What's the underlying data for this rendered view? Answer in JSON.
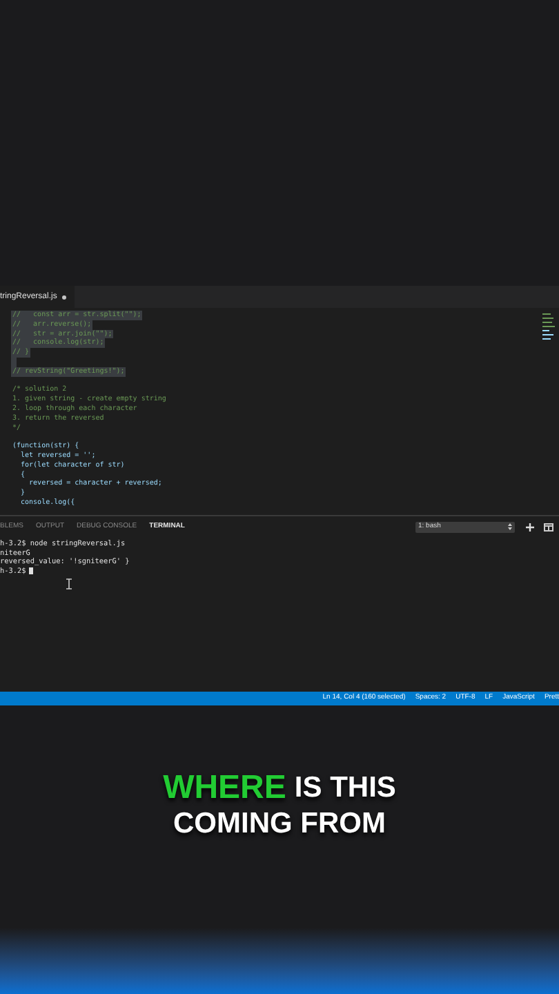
{
  "editor": {
    "tab": {
      "title": "tringReversal.js",
      "modified": true
    },
    "lines": [
      {
        "kind": "comment",
        "text": "//   const arr = str.split(\"\");",
        "selected": true
      },
      {
        "kind": "comment",
        "text": "//   arr.reverse();",
        "selected": true
      },
      {
        "kind": "comment",
        "text": "//   str = arr.join(\"\");",
        "selected": true
      },
      {
        "kind": "comment",
        "text": "//   console.log(str);",
        "selected": true
      },
      {
        "kind": "comment",
        "text": "// }",
        "selected": true
      },
      {
        "kind": "blank",
        "selected": true
      },
      {
        "kind": "comment",
        "text": "// revString(\"Greetings!\");",
        "selected": true
      },
      {
        "kind": "blank",
        "selected": false
      },
      {
        "kind": "comment",
        "text": "/* solution 2",
        "selected": false
      },
      {
        "kind": "comment",
        "text": "1. given string - create empty string",
        "selected": false
      },
      {
        "kind": "comment",
        "text": "2. loop through each character",
        "selected": false
      },
      {
        "kind": "comment",
        "text": "3. return the reversed",
        "selected": false
      },
      {
        "kind": "comment",
        "text": "*/",
        "selected": false
      },
      {
        "kind": "blank",
        "selected": false
      },
      {
        "kind": "code",
        "text": "(function(str) {",
        "selected": false
      },
      {
        "kind": "code",
        "text": "  let reversed = '';",
        "selected": false
      },
      {
        "kind": "code",
        "text": "  for(let character of str)",
        "selected": false
      },
      {
        "kind": "code",
        "text": "  {",
        "selected": false
      },
      {
        "kind": "code",
        "text": "    reversed = character + reversed;",
        "selected": false
      },
      {
        "kind": "code",
        "text": "  }",
        "selected": false
      },
      {
        "kind": "code",
        "text": "  console.log({",
        "selected": false
      }
    ]
  },
  "panel": {
    "tabs": [
      {
        "label": "BLEMS",
        "selected": false
      },
      {
        "label": "OUTPUT",
        "selected": false
      },
      {
        "label": "DEBUG CONSOLE",
        "selected": false
      },
      {
        "label": "TERMINAL",
        "selected": true
      }
    ],
    "shell": "1: bash",
    "terminal": [
      "h-3.2$ node stringReversal.js",
      "niteerG",
      "reversed_value: '!sgniteerG' }",
      "h-3.2$"
    ]
  },
  "status_bar": [
    "Ln 14, Col 4 (160 selected)",
    "Spaces: 2",
    "UTF-8",
    "LF",
    "JavaScript",
    "Prett"
  ],
  "caption": [
    [
      {
        "text": "WHERE",
        "highlight": true
      },
      {
        "text": "IS THIS",
        "highlight": false
      }
    ],
    [
      {
        "text": "COMING FROM",
        "highlight": false
      }
    ]
  ]
}
